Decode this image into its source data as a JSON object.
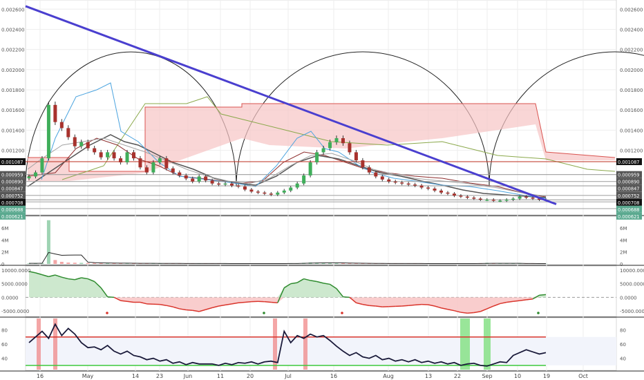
{
  "chart_data": [
    {
      "type": "candlestick",
      "panel": "price",
      "yticks": [
        "0.002600",
        "0.002400",
        "0.002200",
        "0.002000",
        "0.001800",
        "0.001600",
        "0.001400",
        "0.001200"
      ],
      "price_labels": [
        {
          "value": "0.001087",
          "color": "#111111"
        },
        {
          "value": "0.000959",
          "color": "#555555"
        },
        {
          "value": "0.000890",
          "color": "#555555"
        },
        {
          "value": "0.000847",
          "color": "#555555"
        },
        {
          "value": "0.000752",
          "color": "#555555"
        },
        {
          "value": "0.000708",
          "color": "#111111"
        },
        {
          "value": "0.000688",
          "color": "#5aa98f"
        },
        {
          "value": "0.000621",
          "color": "#5aa98f"
        }
      ],
      "levels": [
        0.001087,
        0.000959,
        0.00089,
        0.000847,
        0.000752,
        0.000708,
        0.000688,
        0.000621
      ],
      "ylim": [
        0.0006,
        0.00265
      ],
      "trendline": {
        "start": 0.00263,
        "end": 0.000665,
        "color": "#4a3fcf"
      },
      "candles_close": [
        0.00094,
        0.00098,
        0.00112,
        0.00165,
        0.00148,
        0.00142,
        0.00133,
        0.00124,
        0.00128,
        0.00122,
        0.00118,
        0.00113,
        0.00118,
        0.00112,
        0.00108,
        0.00118,
        0.00112,
        0.00103,
        0.00098,
        0.00108,
        0.00112,
        0.00102,
        0.00098,
        0.00095,
        0.00092,
        0.00089,
        0.00094,
        0.0009,
        0.00087,
        0.00086,
        0.00087,
        0.00085,
        0.00084,
        0.00081,
        0.00079,
        0.00078,
        0.00077,
        0.00076,
        0.00078,
        0.0008,
        0.00083,
        0.00087,
        0.00095,
        0.00108,
        0.00118,
        0.00122,
        0.00128,
        0.00132,
        0.00127,
        0.00118,
        0.0011,
        0.00103,
        0.00098,
        0.00094,
        0.00091,
        0.00089,
        0.00088,
        0.00087,
        0.00086,
        0.00085,
        0.00083,
        0.00082,
        0.0008,
        0.00078,
        0.00077,
        0.00075,
        0.00074,
        0.00073,
        0.00072,
        0.00071,
        0.00071,
        0.0007,
        0.0007,
        0.00071,
        0.00072,
        0.00074,
        0.00073,
        0.00072,
        0.00071,
        0.00071
      ]
    },
    {
      "type": "bar",
      "panel": "volume",
      "yticks": [
        "6M",
        "4M",
        "2M",
        "0"
      ],
      "ylim": [
        0,
        7500000
      ],
      "values": [
        100000,
        110000,
        150000,
        7300000,
        650000,
        350000,
        230000,
        200000,
        180000,
        160000,
        150000,
        140000,
        130000,
        120000,
        110000,
        100000,
        95000,
        90000,
        88000,
        85000,
        82000,
        80000,
        78000,
        75000,
        72000,
        70000,
        68000,
        66000,
        64000,
        62000,
        60000,
        58000,
        56000,
        55000,
        54000,
        53000,
        52000,
        51000,
        50000,
        110000,
        90000,
        88000,
        180000,
        250000,
        220000,
        190000,
        160000,
        120000,
        110000,
        100000,
        90000,
        85000,
        80000,
        76000,
        72000,
        70000,
        68000,
        66000,
        64000,
        62000,
        60000,
        58000,
        56000,
        55000,
        54000,
        53000,
        52000,
        51000,
        60000,
        120000,
        180000,
        100000,
        90000,
        80000,
        70000,
        65000,
        60000,
        55000,
        50000,
        48000
      ]
    },
    {
      "type": "area",
      "panel": "oscillator",
      "yticks": [
        "10000.0000",
        "5000.0000",
        "0.0000",
        "-5000.0000"
      ],
      "ylim": [
        -6500,
        11000
      ],
      "values": [
        9500,
        9000,
        8300,
        7600,
        8200,
        7400,
        6800,
        6500,
        7200,
        6800,
        5800,
        3500,
        200,
        0,
        -1200,
        -1500,
        -1800,
        -1800,
        -2400,
        -2500,
        -2600,
        -3000,
        -3500,
        -4200,
        -4600,
        -4800,
        -5200,
        -4500,
        -3800,
        -3200,
        -2800,
        -2400,
        -2000,
        -1800,
        -1600,
        -1500,
        -1600,
        -1800,
        -2000,
        3500,
        5000,
        5400,
        6800,
        6200,
        5800,
        5200,
        4800,
        3200,
        200,
        0,
        -2000,
        -2600,
        -3000,
        -3200,
        -3500,
        -3400,
        -3300,
        -3200,
        -3000,
        -2800,
        -2600,
        -2700,
        -3200,
        -3900,
        -4400,
        -4900,
        -5500,
        -5800,
        -5600,
        -5200,
        -4200,
        -3200,
        -2300,
        -1800,
        -1500,
        -1200,
        -900,
        -600,
        800,
        1000
      ]
    },
    {
      "type": "line",
      "panel": "rsi",
      "yticks": [
        "80",
        "60",
        "40"
      ],
      "bands": {
        "upper": 70,
        "lower": 30
      },
      "ylim": [
        25,
        95
      ],
      "values": [
        62,
        70,
        78,
        68,
        88,
        72,
        82,
        74,
        62,
        55,
        56,
        52,
        58,
        50,
        46,
        50,
        44,
        42,
        38,
        40,
        36,
        38,
        33,
        35,
        31,
        34,
        32,
        32,
        32,
        30,
        33,
        31,
        34,
        33,
        35,
        32,
        35,
        36,
        34,
        78,
        62,
        72,
        68,
        74,
        70,
        72,
        65,
        57,
        50,
        44,
        48,
        42,
        40,
        44,
        38,
        40,
        36,
        38,
        35,
        38,
        34,
        36,
        33,
        35,
        32,
        34,
        30,
        32,
        33,
        30,
        29,
        32,
        35,
        34,
        44,
        48,
        52,
        49,
        46,
        48
      ]
    }
  ],
  "time_axis": {
    "labels": [
      "16",
      "May",
      "14",
      "23",
      "Jun",
      "11",
      "20",
      "Jul",
      "16",
      "Aug",
      "13",
      "22",
      "Sep",
      "10",
      "19",
      "Oct"
    ]
  },
  "ichimoku": {
    "cloud_red": "#f2a7a7",
    "cloud_green": "#b6d7a8"
  }
}
